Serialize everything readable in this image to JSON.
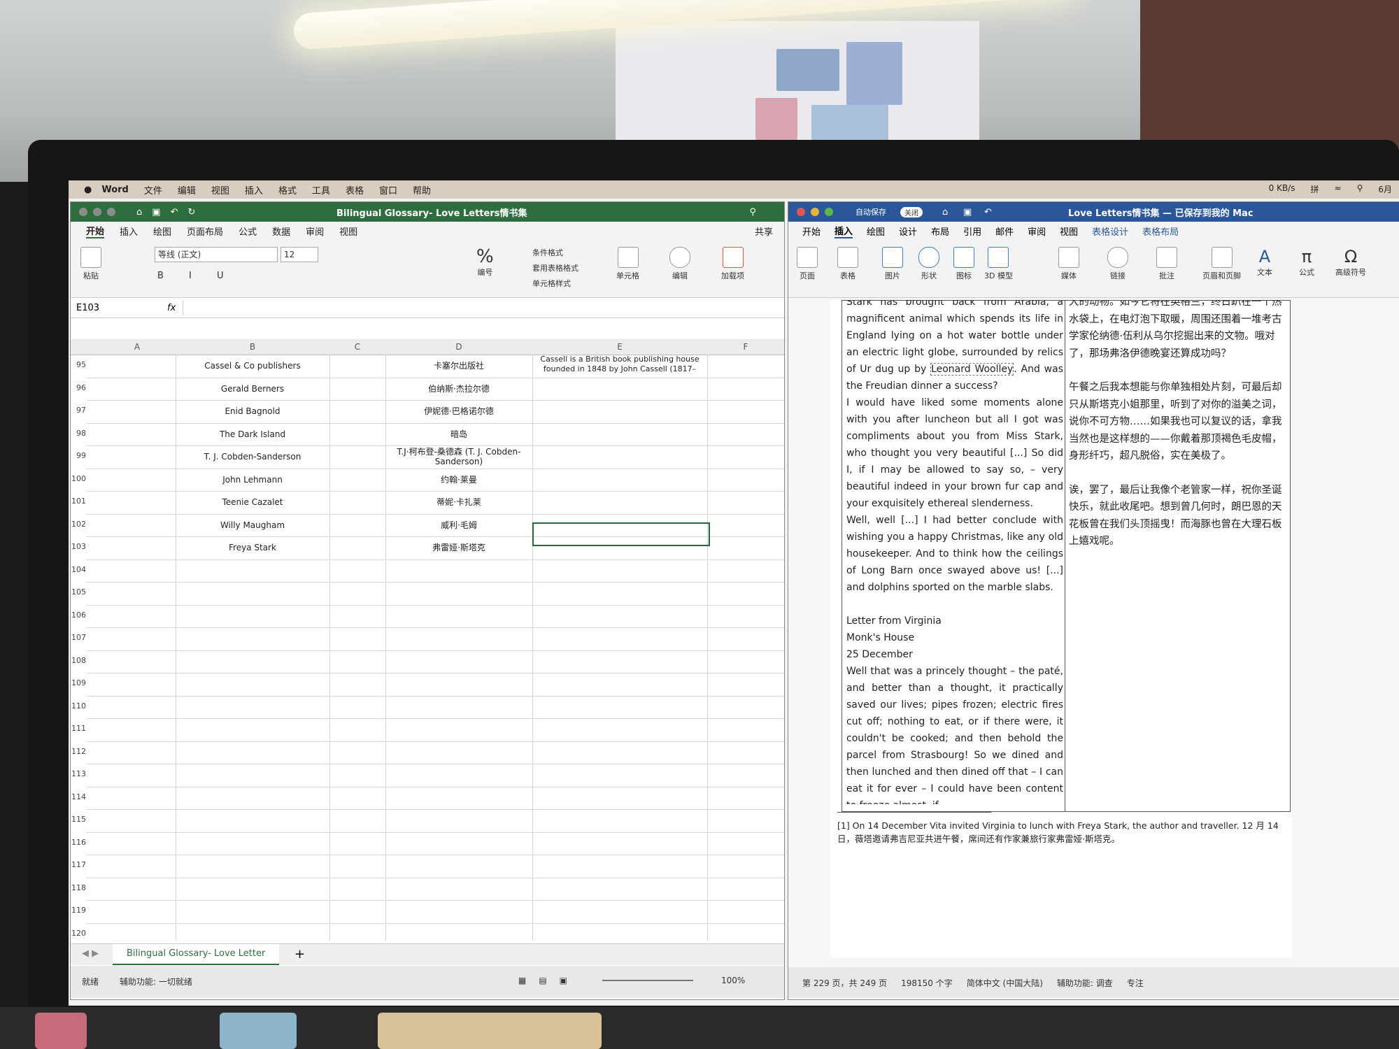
{
  "menubar": {
    "apple": "",
    "app": "Word",
    "items": [
      "文件",
      "编辑",
      "视图",
      "插入",
      "格式",
      "工具",
      "表格",
      "窗口",
      "帮助"
    ],
    "net_speed": "0 KB/s",
    "ime": "拼",
    "date": "6月"
  },
  "excel": {
    "title": "Bilingual Glossary- Love Letters情书集",
    "tabs": [
      "开始",
      "插入",
      "绘图",
      "页面布局",
      "公式",
      "数据",
      "审阅",
      "视图"
    ],
    "share": "共享",
    "ribbon": {
      "paste": "粘贴",
      "font": "等线 (正文)",
      "size": "12",
      "number_format": "编号",
      "cond_format": "条件格式",
      "table_format": "套用表格格式",
      "cell_style": "单元格样式",
      "cells": "单元格",
      "edit": "编辑",
      "addins": "加载项"
    },
    "name_box": "E103",
    "fx": "fx",
    "columns": [
      "A",
      "B",
      "C",
      "D",
      "E",
      "F"
    ],
    "rows": [
      {
        "n": "95",
        "b": "Cassel & Co publishers",
        "d": "卡塞尔出版社",
        "e": "Cassell is a British book publishing house founded in 1848 by John Cassell (1817–"
      },
      {
        "n": "96",
        "b": "Gerald Berners",
        "d": "伯纳斯·杰拉尔德",
        "e": ""
      },
      {
        "n": "97",
        "b": "Enid Bagnold",
        "d": "伊妮德·巴格诺尔德",
        "e": ""
      },
      {
        "n": "98",
        "b": "The Dark Island",
        "d": "暗岛",
        "e": ""
      },
      {
        "n": "99",
        "b": "T. J. Cobden-Sanderson",
        "d": "T.J·柯布登-桑德森 (T. J. Cobden-Sanderson)",
        "e": ""
      },
      {
        "n": "100",
        "b": "John Lehmann",
        "d": "约翰·莱曼",
        "e": ""
      },
      {
        "n": "101",
        "b": "Teenie Cazalet",
        "d": "蒂妮·卡扎莱",
        "e": ""
      },
      {
        "n": "102",
        "b": "Willy Maugham",
        "d": "威利·毛姆",
        "e": ""
      },
      {
        "n": "103",
        "b": "Freya Stark",
        "d": "弗雷娅·斯塔克",
        "e": ""
      },
      {
        "n": "104",
        "b": "",
        "d": "",
        "e": ""
      },
      {
        "n": "105",
        "b": "",
        "d": "",
        "e": ""
      },
      {
        "n": "106",
        "b": "",
        "d": "",
        "e": ""
      },
      {
        "n": "107",
        "b": "",
        "d": "",
        "e": ""
      },
      {
        "n": "108",
        "b": "",
        "d": "",
        "e": ""
      },
      {
        "n": "109",
        "b": "",
        "d": "",
        "e": ""
      },
      {
        "n": "110",
        "b": "",
        "d": "",
        "e": ""
      },
      {
        "n": "111",
        "b": "",
        "d": "",
        "e": ""
      },
      {
        "n": "112",
        "b": "",
        "d": "",
        "e": ""
      },
      {
        "n": "113",
        "b": "",
        "d": "",
        "e": ""
      },
      {
        "n": "114",
        "b": "",
        "d": "",
        "e": ""
      },
      {
        "n": "115",
        "b": "",
        "d": "",
        "e": ""
      },
      {
        "n": "116",
        "b": "",
        "d": "",
        "e": ""
      },
      {
        "n": "117",
        "b": "",
        "d": "",
        "e": ""
      },
      {
        "n": "118",
        "b": "",
        "d": "",
        "e": ""
      },
      {
        "n": "119",
        "b": "",
        "d": "",
        "e": ""
      },
      {
        "n": "120",
        "b": "",
        "d": "",
        "e": ""
      }
    ],
    "sheet_tab": "Bilingual Glossary- Love Letter",
    "status_ready": "就绪",
    "status_accessibility": "辅助功能: 一切就绪",
    "zoom": "100%"
  },
  "word": {
    "autosave": "自动保存",
    "autosave_state": "关闭",
    "title": "Love Letters情书集 — 已保存到我的 Mac",
    "tabs": [
      "开始",
      "插入",
      "绘图",
      "设计",
      "布局",
      "引用",
      "邮件",
      "审阅",
      "视图",
      "表格设计",
      "表格布局"
    ],
    "ribbon": [
      "页面",
      "表格",
      "图片",
      "形状",
      "图标",
      "3D 模型",
      "媒体",
      "链接",
      "批注",
      "页眉和页脚",
      "文本",
      "公式",
      "高级符号"
    ],
    "en_paragraphs": [
      "Stark has brought back from Arabia, a magnificent animal which spends its life in England lying on a hot water bottle under an electric light globe, surrounded by relics of Ur dug up by",
      "Leonard Woolley",
      ". And was the Freudian dinner a success?",
      "I would have liked some moments alone with you after luncheon but all I got was compliments about you from Miss Stark, who thought you very beautiful [...] So did I, if I may be allowed to say so, – very beautiful indeed in your brown fur cap and your exquisitely ethereal slenderness.",
      "Well, well [...] I had better conclude with wishing you a happy Christmas, like any old housekeeper. And to think how the ceilings of Long Barn once swayed above us! [...] and dolphins sported on the marble slabs.",
      "Letter from Virginia",
      "Monk's House",
      "25 December",
      "Well that was a princely thought – the paté, and better than a thought, it practically saved our lives; pipes frozen; electric fires cut off; nothing to eat, or if there were, it couldn't be cooked; and then behold the parcel from Strasbourg! So we dined and then lunched and then dined off that – I can eat it for ever – I could have been content to freeze almost, if"
    ],
    "zh_paragraphs": [
      "大的动物。如今它将在英格兰，终日趴在一个热水袋上，在电灯泡下取暖，周围还围着一堆考古学家伦纳德·伍利从乌尔挖掘出来的文物。哦对了，那场弗洛伊德晚宴还算成功吗？",
      "午餐之后我本想能与你单独相处片刻，可最后却只从斯塔克小姐那里，听到了对你的溢美之词，说你不可方物……如果我也可以复议的话，拿我当然也是这样想的——你戴着那顶褐色毛皮帽，身形纤巧，超凡脱俗，实在美极了。",
      "诶，罢了，最后让我像个老管家一样，祝你圣诞快乐，就此收尾吧。想到曾几何时，朗巴恩的天花板曾在我们头顶摇曳！而海豚也曾在大理石板上嬉戏呢。"
    ],
    "footnote": "[1] On 14 December Vita invited Virginia to lunch with Freya Stark, the author and traveller. 12 月 14 日，薇塔邀请弗吉尼亚共进午餐，席间还有作家兼旅行家弗雷娅·斯塔克。",
    "status_pages": "第 229 页，共 249 页",
    "status_words": "198150 个字",
    "status_lang": "简体中文 (中国大陆)",
    "status_accessibility": "辅助功能: 调查",
    "status_focus": "专注"
  }
}
